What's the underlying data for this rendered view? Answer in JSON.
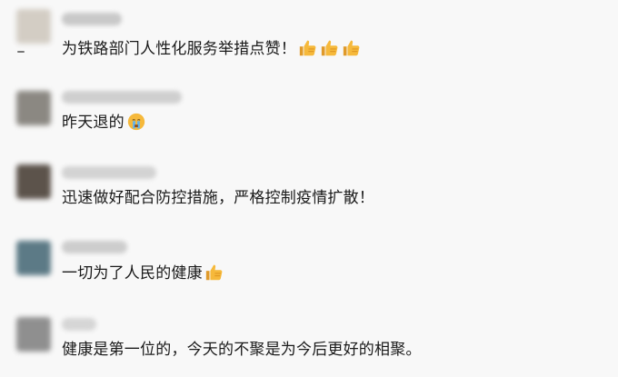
{
  "comments": [
    {
      "text": "为铁路部门人性化服务举措点赞！",
      "emojis": [
        "thumbs-up",
        "thumbs-up",
        "thumbs-up"
      ],
      "avatar_color": "#cfc9c0"
    },
    {
      "text": "昨天退的",
      "emojis": [
        "loudly-crying-face"
      ],
      "avatar_color": "#8c8a85"
    },
    {
      "text": "迅速做好配合防控措施，严格控制疫情扩散！",
      "emojis": [],
      "avatar_color": "#5a5149"
    },
    {
      "text": "一切为了人民的健康",
      "emojis": [
        "thumbs-up"
      ],
      "avatar_color": "#5d7a86"
    },
    {
      "text": "健康是第一位的，今天的不聚是为今后更好的相聚。",
      "emojis": [],
      "avatar_color": "#8d8d8d"
    }
  ],
  "colors": {
    "background": "#f8f8f8",
    "text": "#1a1a1a",
    "emoji_yellow": "#f6b93b"
  }
}
